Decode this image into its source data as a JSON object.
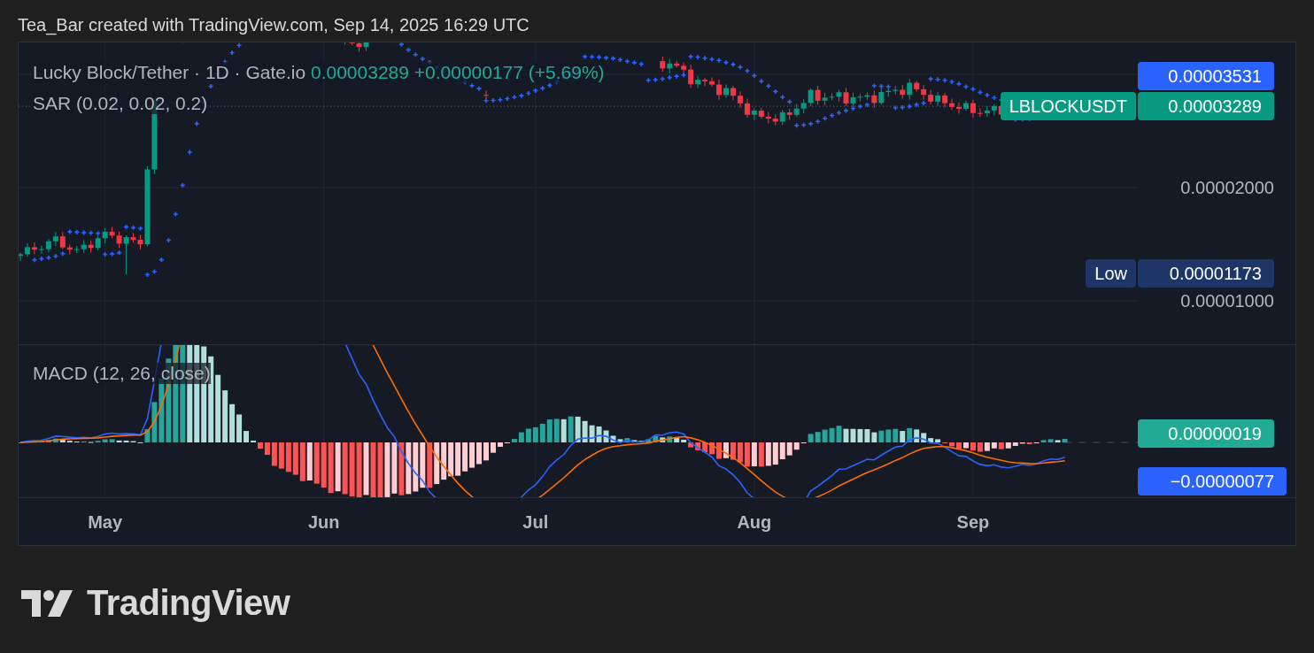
{
  "header": {
    "caption": "Tea_Bar created with TradingView.com, Sep 14, 2025 16:29 UTC"
  },
  "price_pane": {
    "symbol_title": "Lucky Block/Tether · 1D · Gate.io",
    "last_price": "0.00003289",
    "change": "+0.00000177 (+5.69%)",
    "indicator": "SAR (0.02, 0.02, 0.2)",
    "axis_labels": [
      "0.00002000",
      "0.00001000"
    ],
    "badges": [
      {
        "kind": "value",
        "value": "0.00003531",
        "color": "#2962ff"
      },
      {
        "kind": "labeled",
        "label": "LBLOCKUSDT",
        "value": "0.00003289",
        "color": "#089981"
      },
      {
        "kind": "labeled",
        "label": "Low",
        "value": "0.00001173",
        "color": "#1e3567"
      }
    ]
  },
  "macd_pane": {
    "indicator": "MACD (12, 26, close)",
    "badges": [
      {
        "kind": "value",
        "value": "0.00000019",
        "color": "#22ab94"
      },
      {
        "kind": "value",
        "value": "−0.00000077",
        "color": "#2962ff"
      }
    ]
  },
  "time_axis": [
    "May",
    "Jun",
    "Jul",
    "Aug",
    "Sep"
  ],
  "footer": {
    "logo_text": "TradingView"
  }
}
